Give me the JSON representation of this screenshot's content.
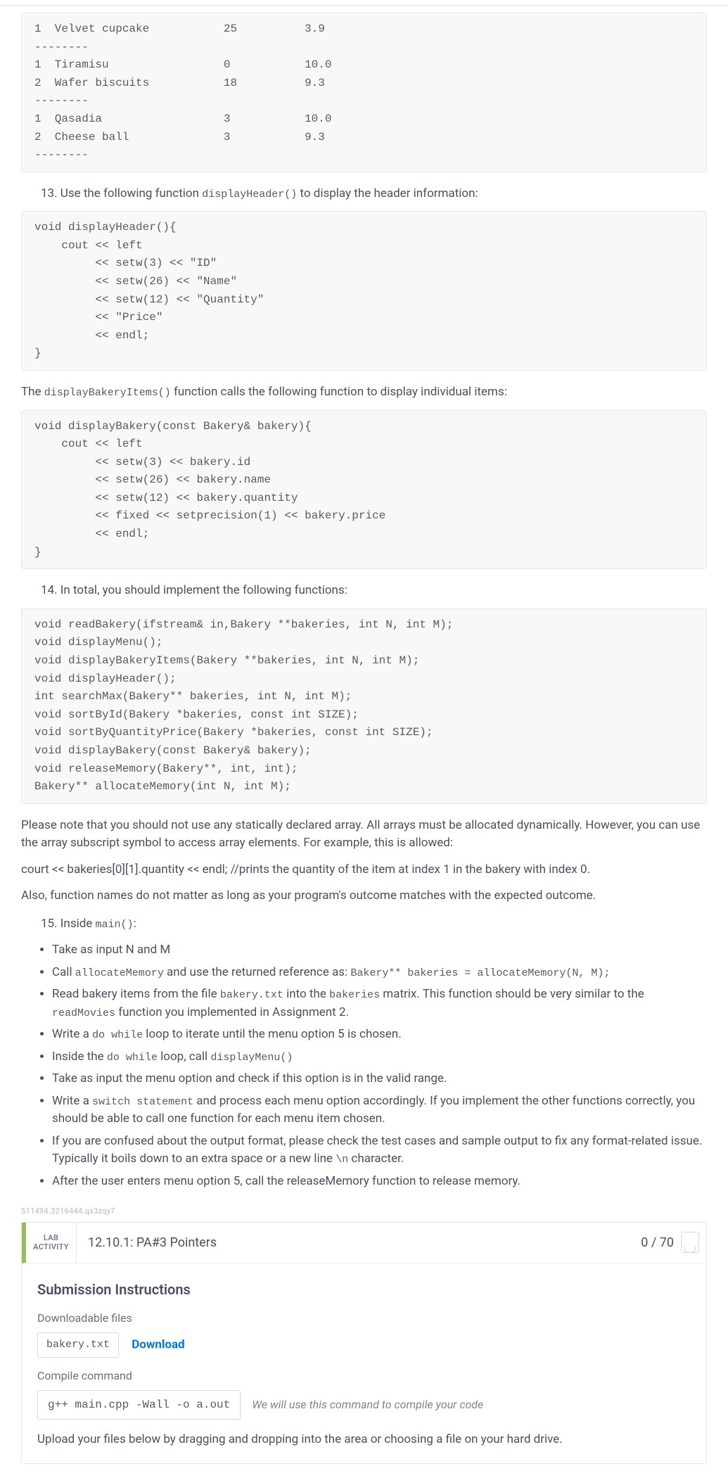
{
  "output_table": "1  Velvet cupcake           25          3.9\n--------\n1  Tiramisu                 0           10.0\n2  Wafer biscuits           18          9.3\n--------\n1  Qasadia                  3           10.0\n2  Cheese ball              3           9.3\n--------",
  "item13": {
    "prefix": "13. Use the following function ",
    "code": "displayHeader()",
    "suffix": " to display the header information:"
  },
  "code_displayHeader": "void displayHeader(){\n    cout << left\n         << setw(3) << \"ID\"\n         << setw(26) << \"Name\"\n         << setw(12) << \"Quantity\"\n         << \"Price\"\n         << endl;\n}",
  "after_header": {
    "prefix": "The ",
    "code": "displayBakeryItems()",
    "suffix": " function calls the following function to display individual items:"
  },
  "code_displayBakery": "void displayBakery(const Bakery& bakery){\n    cout << left\n         << setw(3) << bakery.id\n         << setw(26) << bakery.name\n         << setw(12) << bakery.quantity\n         << fixed << setprecision(1) << bakery.price\n         << endl;\n}",
  "item14": "14. In total, you should implement the following functions:",
  "code_signatures": "void readBakery(ifstream& in,Bakery **bakeries, int N, int M);\nvoid displayMenu();\nvoid displayBakeryItems(Bakery **bakeries, int N, int M);\nvoid displayHeader();\nint searchMax(Bakery** bakeries, int N, int M);\nvoid sortById(Bakery *bakeries, const int SIZE);\nvoid sortByQuantityPrice(Bakery *bakeries, const int SIZE);\nvoid displayBakery(const Bakery& bakery);\nvoid releaseMemory(Bakery**, int, int);\nBakery** allocateMemory(int N, int M);",
  "para_note1": "Please note that you should not use any statically declared array. All arrays must be allocated dynamically. However, you can use the array subscript symbol to access array elements. For example, this is allowed:",
  "para_example": "court << bakeries[0][1].quantity << endl; //prints the quantity of the item at index 1 in the bakery with index 0.",
  "para_note2": "Also, function names do not matter as long as your program's outcome matches with the expected outcome.",
  "item15": {
    "prefix": "15. Inside ",
    "code": "main()",
    "suffix": ":"
  },
  "bullets": [
    {
      "spans": [
        {
          "t": "Take as input N and M"
        }
      ]
    },
    {
      "spans": [
        {
          "t": "Call "
        },
        {
          "c": "allocateMemory"
        },
        {
          "t": " and use the returned reference as: "
        },
        {
          "c": "Bakery** bakeries = allocateMemory(N, M);"
        }
      ]
    },
    {
      "spans": [
        {
          "t": "Read bakery items from the file "
        },
        {
          "c": "bakery.txt"
        },
        {
          "t": " into the "
        },
        {
          "c": "bakeries"
        },
        {
          "t": " matrix. This function should be very similar to the "
        },
        {
          "c": "readMovies"
        },
        {
          "t": " function you implemented in Assignment 2."
        }
      ]
    },
    {
      "spans": [
        {
          "t": "Write a "
        },
        {
          "c": "do while"
        },
        {
          "t": " loop to iterate until the menu option 5 is chosen."
        }
      ]
    },
    {
      "spans": [
        {
          "t": "Inside the "
        },
        {
          "c": "do while"
        },
        {
          "t": " loop, call "
        },
        {
          "c": "displayMenu()"
        }
      ]
    },
    {
      "spans": [
        {
          "t": "Take as input the menu option and check if this option is in the valid range."
        }
      ]
    },
    {
      "spans": [
        {
          "t": "Write a "
        },
        {
          "c": "switch statement"
        },
        {
          "t": " and process each menu option accordingly. If you implement the other functions correctly, you should be able to call one function for each menu item chosen."
        }
      ]
    },
    {
      "spans": [
        {
          "t": "If you are confused about the output format, please check the test cases and sample output to fix any format-related issue. Typically it boils down to an extra space or a new line "
        },
        {
          "c": "\\n"
        },
        {
          "t": " character."
        }
      ]
    },
    {
      "spans": [
        {
          "t": "After the user enters menu option 5, call the releaseMemory function to release memory."
        }
      ]
    }
  ],
  "tiny_id": "511494.3216444.qx3zqy7",
  "lab": {
    "tag1": "LAB",
    "tag2": "ACTIVITY",
    "title": "12.10.1: PA#3 Pointers",
    "score": "0 / 70"
  },
  "submission": {
    "title": "Submission Instructions",
    "dl_label": "Downloadable files",
    "file": "bakery.txt",
    "download": "Download",
    "compile_label": "Compile command",
    "compile_cmd": "g++ main.cpp -Wall -o a.out",
    "compile_note": "We will use this command to compile your code",
    "upload_note": "Upload your files below by dragging and dropping into the area or choosing a file on your hard drive."
  }
}
